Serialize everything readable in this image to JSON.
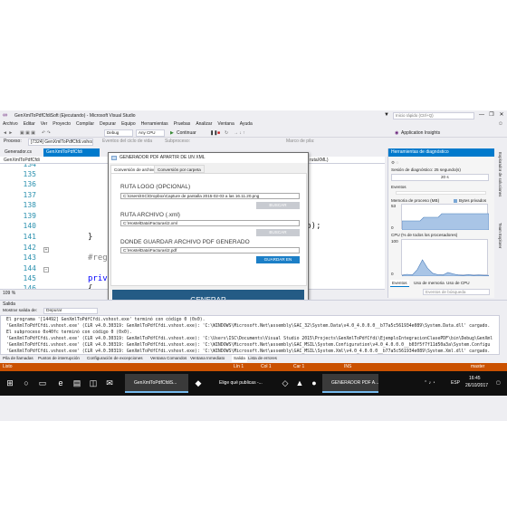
{
  "window": {
    "title": "GenXmlToPdfCfdiSoft (Ejecutando) - Microsoft Visual Studio",
    "quick_launch_placeholder": "Inicio rápido (Ctrl+Q)",
    "minimize": "—",
    "maximize": "❐",
    "close": "✕"
  },
  "menu": [
    "Archivo",
    "Editar",
    "Ver",
    "Proyecto",
    "Compilar",
    "Depurar",
    "Equipo",
    "Herramientas",
    "Pruebas",
    "Analizar",
    "Ventana",
    "Ayuda"
  ],
  "toolbar": {
    "config": "Debug",
    "platform": "Any CPU",
    "continue": "Continuar",
    "app_insights": "Application Insights"
  },
  "process_bar": {
    "label": "Proceso:",
    "process": "[7324] GenXmlToPdfCfdi.vshost.exe",
    "lifecycle": "Eventos del ciclo de vida",
    "thread": "Subproceso:",
    "stack": "Marco de pila:"
  },
  "editor": {
    "tabs": [
      "Generador.cs",
      "GenXmlToPdfCfdi"
    ],
    "nav_project": "GenXmlToPdfCfdi",
    "nav_member": "rutaXML)",
    "zoom": "109 %",
    "line_numbers": [
      "134",
      "135",
      "136",
      "137",
      "138",
      "139",
      "140",
      "141",
      "142",
      "143",
      "144",
      "145",
      "146"
    ],
    "code": {
      "c140": "ento);",
      "c141": "}",
      "c143": "#reg",
      "c145": "priv",
      "c146": "{"
    }
  },
  "dialog": {
    "title": "GENERADOR PDF APARTIR DE UN XML",
    "tabs": [
      "Conversión de archivo",
      "Conversión por carpeta"
    ],
    "logo_label": "RUTA LOGO (OPCIONAL)",
    "logo_value": "C:\\Users\\ISC\\Dropbox\\Capture de pantalla 2015-02-03 a las 16.11.20.png",
    "browse1": "BUSCAR",
    "xml_label": "RUTA ARCHIVO (.xml)",
    "xml_value": "C:\\HostelData\\Facturas\\2.xml",
    "browse2": "BUSCAR",
    "pdf_label": "DONDE GUARDAR  ARCHIVO PDF GENERADO",
    "pdf_value": "C:\\HostelData\\Facturas\\2.pdf",
    "save_in": "GUARDAR EN",
    "generate": "GENERAR"
  },
  "diagnostics": {
    "title": "Herramientas de diagnóstico",
    "session": "Sesión de diagnóstico: 25 segundo(s)",
    "time_label": "20 s",
    "events": "Eventos",
    "memory": "Memoria de proceso (MB)",
    "bytes_private": "Bytes privados",
    "mem_max": "53",
    "mem_min": "0",
    "cpu": "CPU (% de todos los procesadores)",
    "cpu_max": "100",
    "cpu_min": "0",
    "bottom_tabs": [
      "Eventos",
      "Uso de memoria",
      "Uso de CPU"
    ],
    "search": "Eventos de búsqueda",
    "chart_data": {
      "type": "area",
      "title": "CPU (% de todos los procesadores)",
      "ylim": [
        0,
        100
      ],
      "values": [
        2,
        5,
        3,
        18,
        45,
        22,
        8,
        4,
        3,
        10,
        6,
        3,
        2,
        4,
        2,
        3,
        2,
        2
      ]
    }
  },
  "right_sidebar": [
    "Explorador de soluciones",
    "Team Explorer"
  ],
  "output": {
    "title": "Salida",
    "show_from_label": "Mostrar salida de:",
    "source": "Depurar",
    "lines": [
      "El programa '[14492] GenXmlToPdfCfdi.vshost.exe' terminó con código 0 (0x0).",
      "'GenXmlToPdfCfdi.vshost.exe' (CLR v4.0.30319: GenXmlToPdfCfdi.vshost.exe): 'C:\\WINDOWS\\Microsoft.Net\\assembly\\GAC_32\\System.Data\\v4.0_4.0.0.0__b77a5c561934e089\\System.Data.dll' cargado.",
      "El subproceso 0x40fc terminó con código 0 (0x0).",
      "'GenXmlToPdfCfdi.vshost.exe' (CLR v4.0.30319: GenXmlToPdfCfdi.vshost.exe): 'C:\\Users\\ISC\\Documents\\Visual Studio 2015\\Projects\\GenXmlToPdfCfdi\\EjemploIntegracionClasePDF\\bin\\Debug\\GenXml",
      "'GenXmlToPdfCfdi.vshost.exe' (CLR v4.0.30319: GenXmlToPdfCfdi.vshost.exe): 'C:\\WINDOWS\\Microsoft.Net\\assembly\\GAC_MSIL\\System.Configuration\\v4.0_4.0.0.0__b03f5f7f11d50a3a\\System.Configu",
      "'GenXmlToPdfCfdi.vshost.exe' (CLR v4.0.30319: GenXmlToPdfCfdi.vshost.exe): 'C:\\WINDOWS\\Microsoft.Net\\assembly\\GAC_MSIL\\System.Xml\\v4.0_4.0.0.0__b77a5c561934e089\\System.Xml.dll' cargado."
    ]
  },
  "bottom_tabs": [
    "Pila de llamadas",
    "Puntos de interrupción",
    "Configuración de excepciones",
    "Ventana Comandos",
    "Ventana Inmediato",
    "Salida",
    "Lista de errores"
  ],
  "status": {
    "ready": "Listo",
    "line": "Lín 1",
    "col": "Col 1",
    "car": "Car 1",
    "ins": "INS",
    "branch": "master"
  },
  "taskbar": {
    "items": [
      "GenXmlToPdfCfdiS...",
      "Elige qué publicas -...",
      "GENERADOR PDF A..."
    ],
    "lang": "ESP",
    "time": "16:45",
    "date": "26/10/2017"
  },
  "colors": {
    "vs_accent": "#007acc",
    "status_debug": "#ca5100",
    "generate_button": "#245b85"
  }
}
